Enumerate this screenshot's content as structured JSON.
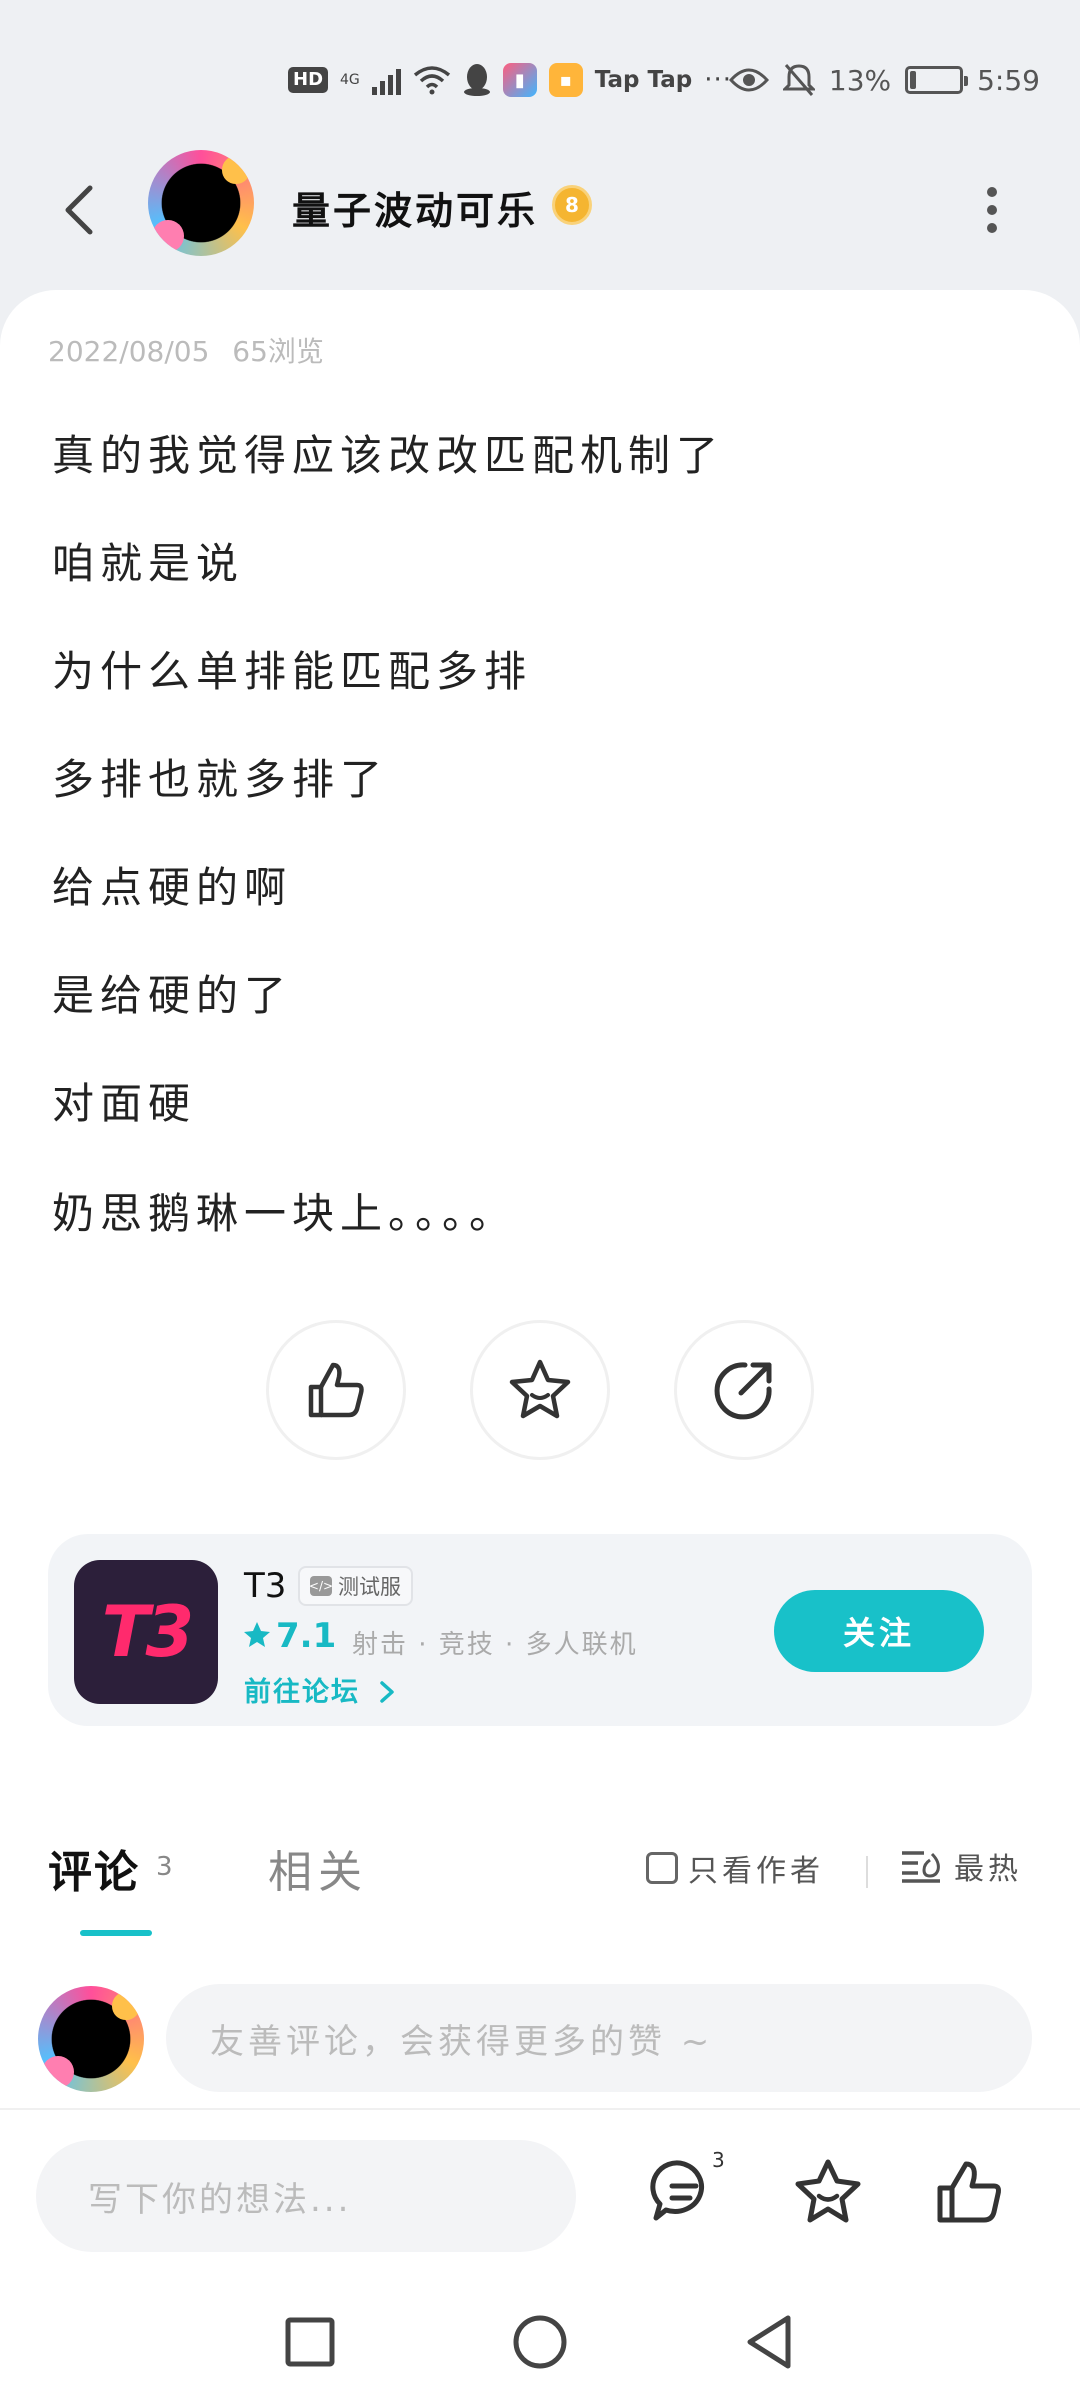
{
  "status_bar": {
    "hd": "HD",
    "network": "4G",
    "tap_text": "Tap Tap",
    "more": "···",
    "battery_percent": "13%",
    "battery_level": 0.13,
    "time": "5:59"
  },
  "header": {
    "username": "量子波动可乐",
    "level": "8"
  },
  "post": {
    "date": "2022/08/05",
    "views": "65浏览",
    "lines": [
      "真的我觉得应该改改匹配机制了",
      "咱就是说",
      "为什么单排能匹配多排",
      "多排也就多排了",
      "给点硬的啊",
      "是给硬的了",
      "对面硬",
      "奶思鹅琳一块上。。。。"
    ]
  },
  "game": {
    "icon_text": "T3",
    "name": "T3",
    "badge": "测试服",
    "rating": "7.1",
    "tags": "射击 · 竞技 · 多人联机",
    "forum_link": "前往论坛",
    "follow_label": "关注",
    "brand_color": "#18c1c9"
  },
  "comments": {
    "tab_comment": "评论",
    "comment_count": "3",
    "tab_related": "相关",
    "author_only": "只看作者",
    "sort": "最热",
    "input_placeholder": "友善评论，会获得更多的赞 ~"
  },
  "bottom_bar": {
    "write_placeholder": "写下你的想法...",
    "comment_count": "3"
  },
  "icons": [
    "back-icon",
    "more-vertical-icon",
    "like-icon",
    "star-icon",
    "share-icon",
    "comment-icon",
    "square-nav-icon",
    "circle-nav-icon",
    "triangle-back-nav-icon"
  ]
}
